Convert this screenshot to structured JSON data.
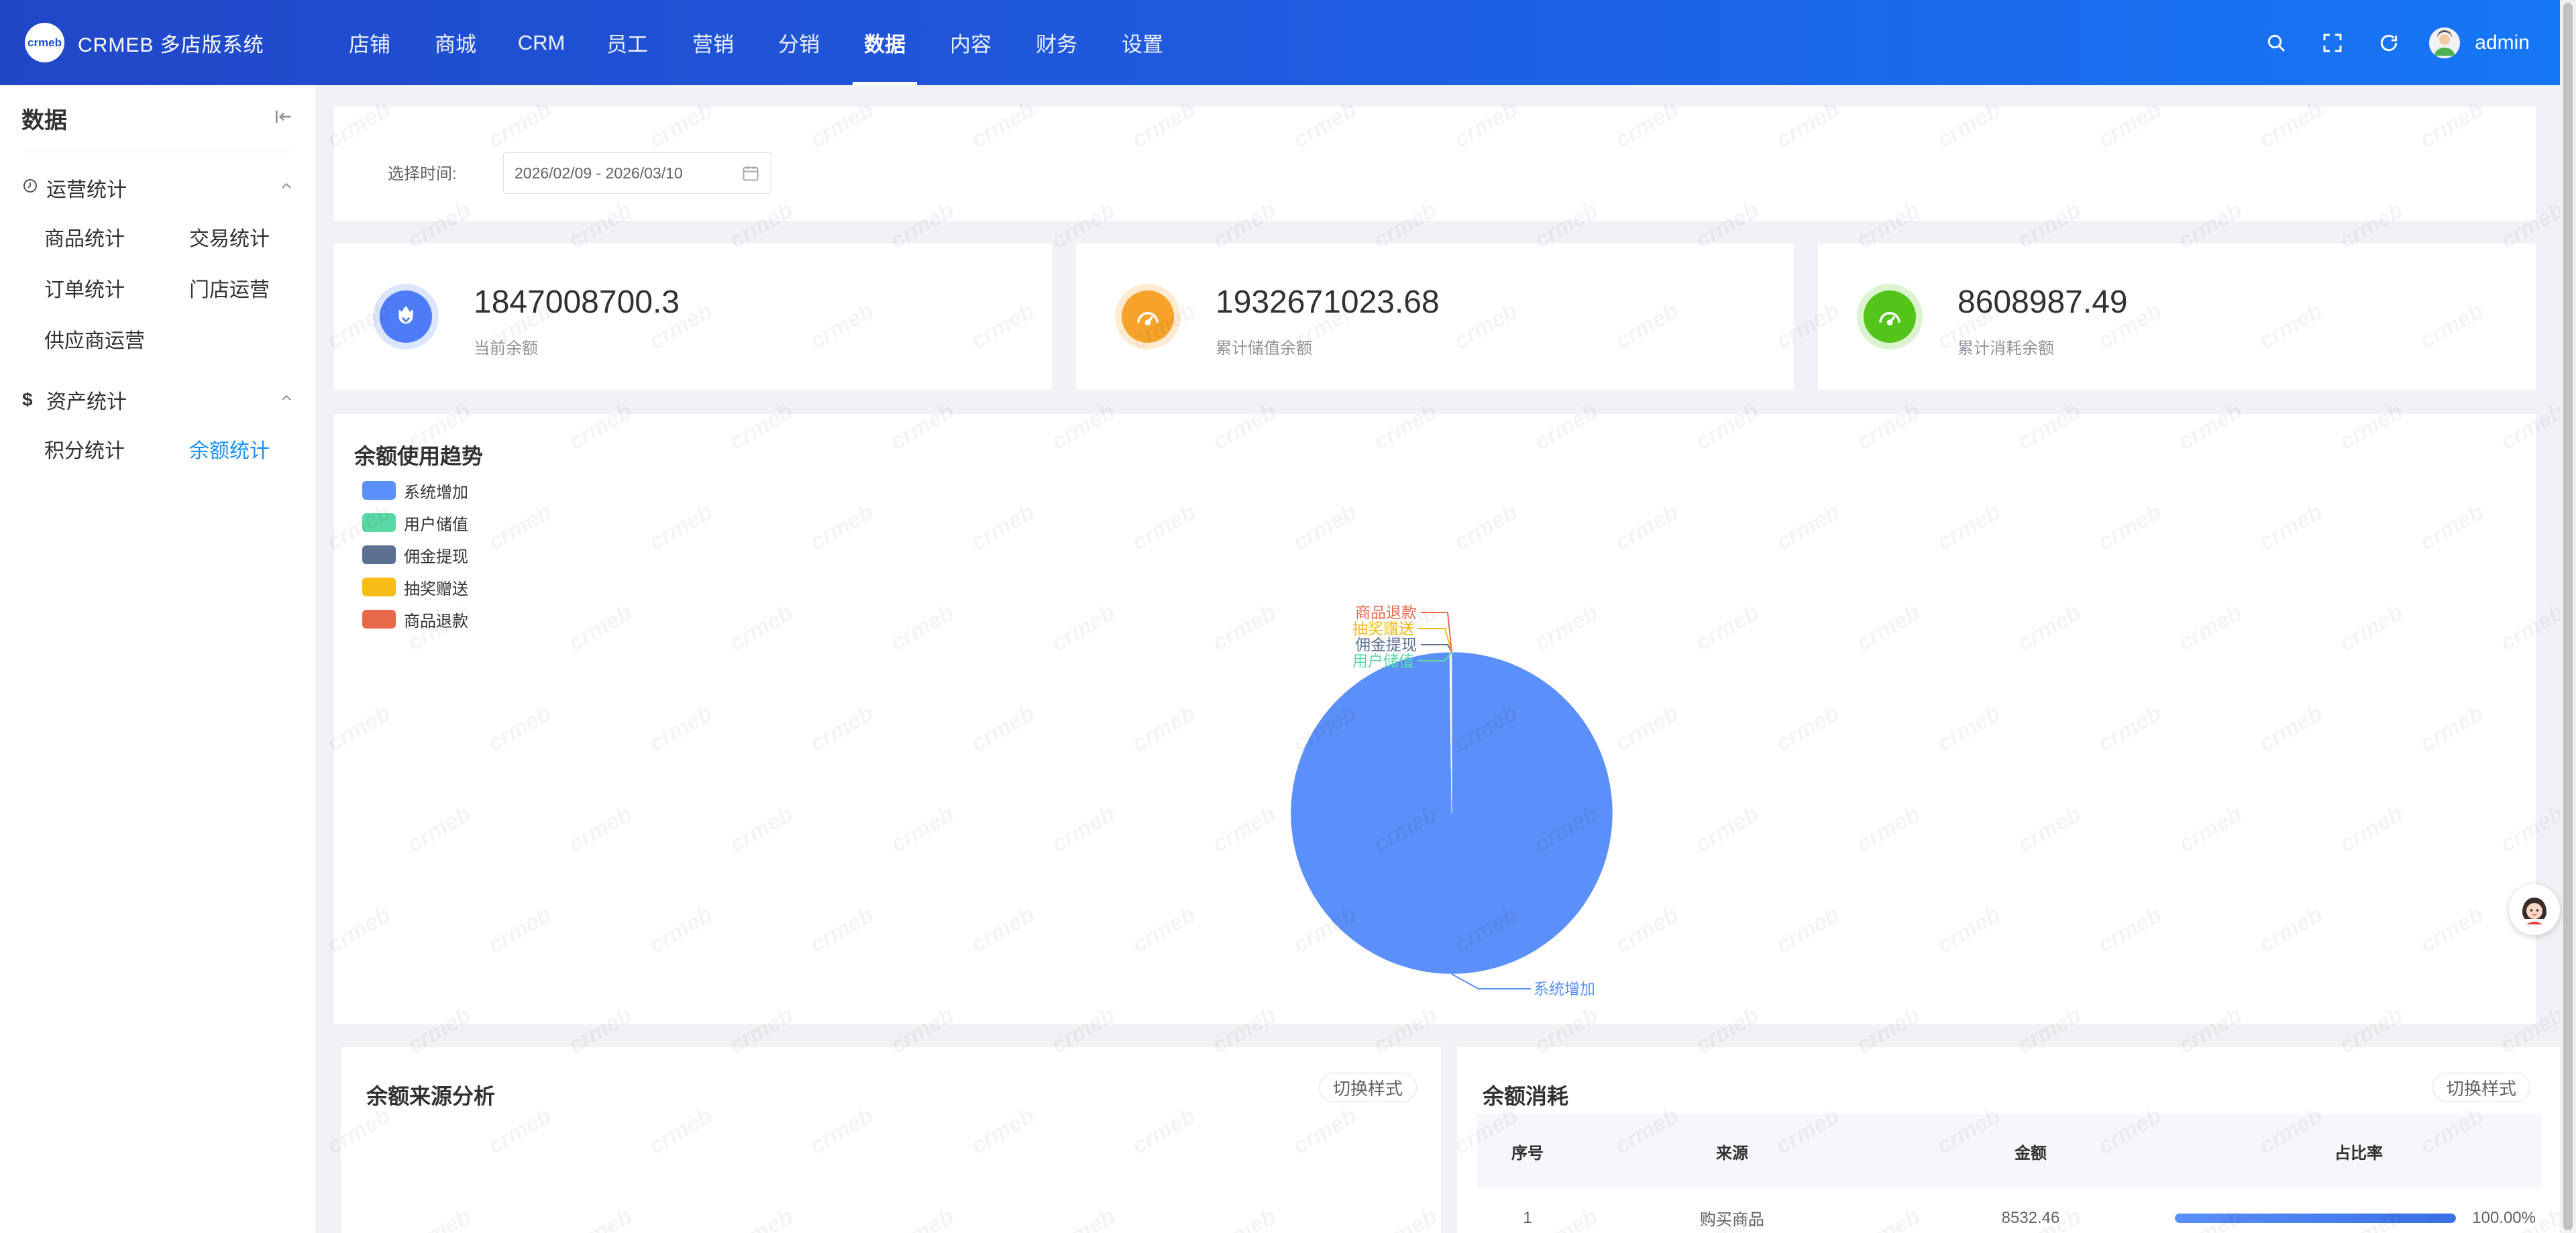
{
  "app": {
    "logo_mark": "crmeb",
    "title": "CRMEB 多店版系统"
  },
  "nav": [
    "店铺",
    "商城",
    "CRM",
    "员工",
    "营销",
    "分销",
    "数据",
    "内容",
    "财务",
    "设置"
  ],
  "nav_active": "数据",
  "header": {
    "user_name": "admin",
    "icons": [
      "search-icon",
      "fullscreen-icon",
      "refresh-icon",
      "user-avatar"
    ]
  },
  "sidebar": {
    "title": "数据",
    "groups": [
      {
        "label": "运营统计",
        "icon": "clock-icon",
        "items": [
          "商品统计",
          "交易统计",
          "订单统计",
          "门店运营",
          "供应商运营"
        ]
      },
      {
        "label": "资产统计",
        "icon": "dollar-icon",
        "items": [
          "积分统计",
          "余额统计"
        ]
      }
    ],
    "active_item": "余额统计"
  },
  "filter": {
    "label": "选择时间:",
    "date_range": "2026/02/09 - 2026/03/10"
  },
  "stats": [
    {
      "value": "1847008700.3",
      "label": "当前余额",
      "color": "#4e7cf6",
      "ring": "#dbe5fd",
      "icon": "balance-icon"
    },
    {
      "value": "1932671023.68",
      "label": "累计储值余额",
      "color": "#f7a22b",
      "ring": "#fdebd2",
      "icon": "gauge-icon"
    },
    {
      "value": "8608987.49",
      "label": "累计消耗余额",
      "color": "#52c41a",
      "ring": "#dcf3cf",
      "icon": "gauge-icon"
    }
  ],
  "trend": {
    "title": "余额使用趋势"
  },
  "chart_data": {
    "type": "pie",
    "title": "余额使用趋势",
    "legend_position": "top-left",
    "slices": [
      {
        "name": "系统增加",
        "value": 99.8,
        "color": "#5b8ff9"
      },
      {
        "name": "用户储值",
        "value": 0.05,
        "color": "#5ad8a6"
      },
      {
        "name": "佣金提现",
        "value": 0.05,
        "color": "#5d7092"
      },
      {
        "name": "抽奖赠送",
        "value": 0.05,
        "color": "#f6bd16"
      },
      {
        "name": "商品退款",
        "value": 0.05,
        "color": "#e8684a"
      }
    ]
  },
  "source_panel": {
    "title": "余额来源分析",
    "switch_label": "切换样式"
  },
  "consume_panel": {
    "title": "余额消耗",
    "switch_label": "切换样式",
    "columns": [
      "序号",
      "来源",
      "金额",
      "占比率"
    ],
    "rows": [
      {
        "index": "1",
        "source": "购买商品",
        "amount": "8532.46",
        "ratio": "100.00%",
        "ratio_value": 100
      }
    ]
  },
  "watermark_text": "crmeb"
}
